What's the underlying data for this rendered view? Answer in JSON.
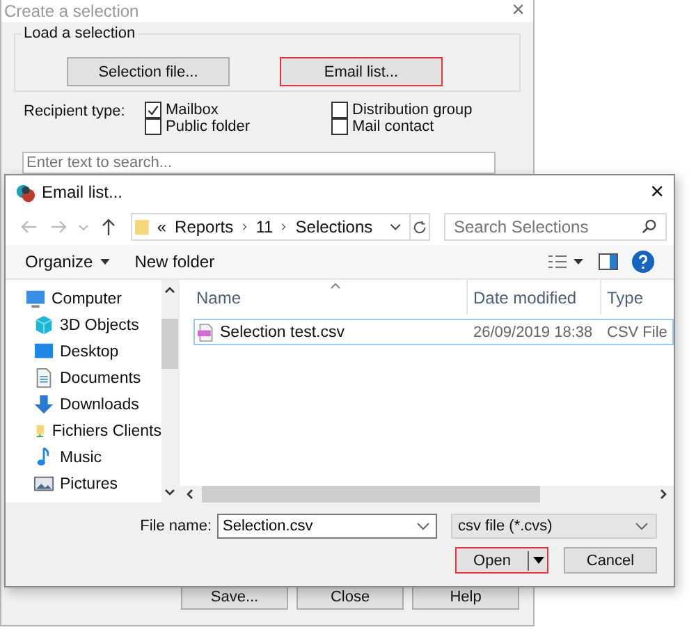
{
  "back_window": {
    "title": "Create a selection",
    "close": "×",
    "group_title": "Load a selection",
    "load_buttons": [
      {
        "label": "Selection file...",
        "highlighted": false
      },
      {
        "label": "Email list...",
        "highlighted": true
      }
    ],
    "recipient_label": "Recipient type:",
    "recipient_types": [
      {
        "label": "Mailbox",
        "checked": true
      },
      {
        "label": "Distribution group",
        "checked": false
      },
      {
        "label": "Public folder",
        "checked": false
      },
      {
        "label": "Mail contact",
        "checked": false
      }
    ],
    "search": {
      "placeholder": "Enter text to search..."
    },
    "buttons": [
      "Save...",
      "Close",
      "Help"
    ]
  },
  "dialog": {
    "title": "Email list...",
    "close": "×",
    "path_prefix": "«",
    "breadcrumb": [
      "Reports",
      "11",
      "Selections"
    ],
    "search": {
      "placeholder": "Search Selections"
    },
    "toolbar": [
      "Organize",
      "New folder"
    ],
    "nav": [
      {
        "label": "Computer",
        "kind": "computer",
        "children": [
          {
            "label": "3D Objects",
            "kind": "cube"
          },
          {
            "label": "Desktop",
            "kind": "desktop"
          },
          {
            "label": "Documents",
            "kind": "document"
          },
          {
            "label": "Downloads",
            "kind": "download"
          },
          {
            "label": "Fichiers Clients",
            "kind": "folder"
          },
          {
            "label": "Music",
            "kind": "music"
          },
          {
            "label": "Pictures",
            "kind": "pictures"
          }
        ]
      }
    ],
    "columns": [
      "Name",
      "Date modified",
      "Type"
    ],
    "rows": [
      {
        "name": "Selection test.csv",
        "date": "26/09/2019 18:38",
        "type": "CSV File",
        "focused": true
      }
    ],
    "file_name_label": "File name:",
    "file_name": "Selection.csv",
    "file_type": "csv file (*.cvs)",
    "buttons": [
      {
        "label": "Open",
        "kind": "split",
        "highlighted": true
      },
      {
        "label": "Cancel",
        "kind": "plain",
        "highlighted": false
      }
    ]
  }
}
